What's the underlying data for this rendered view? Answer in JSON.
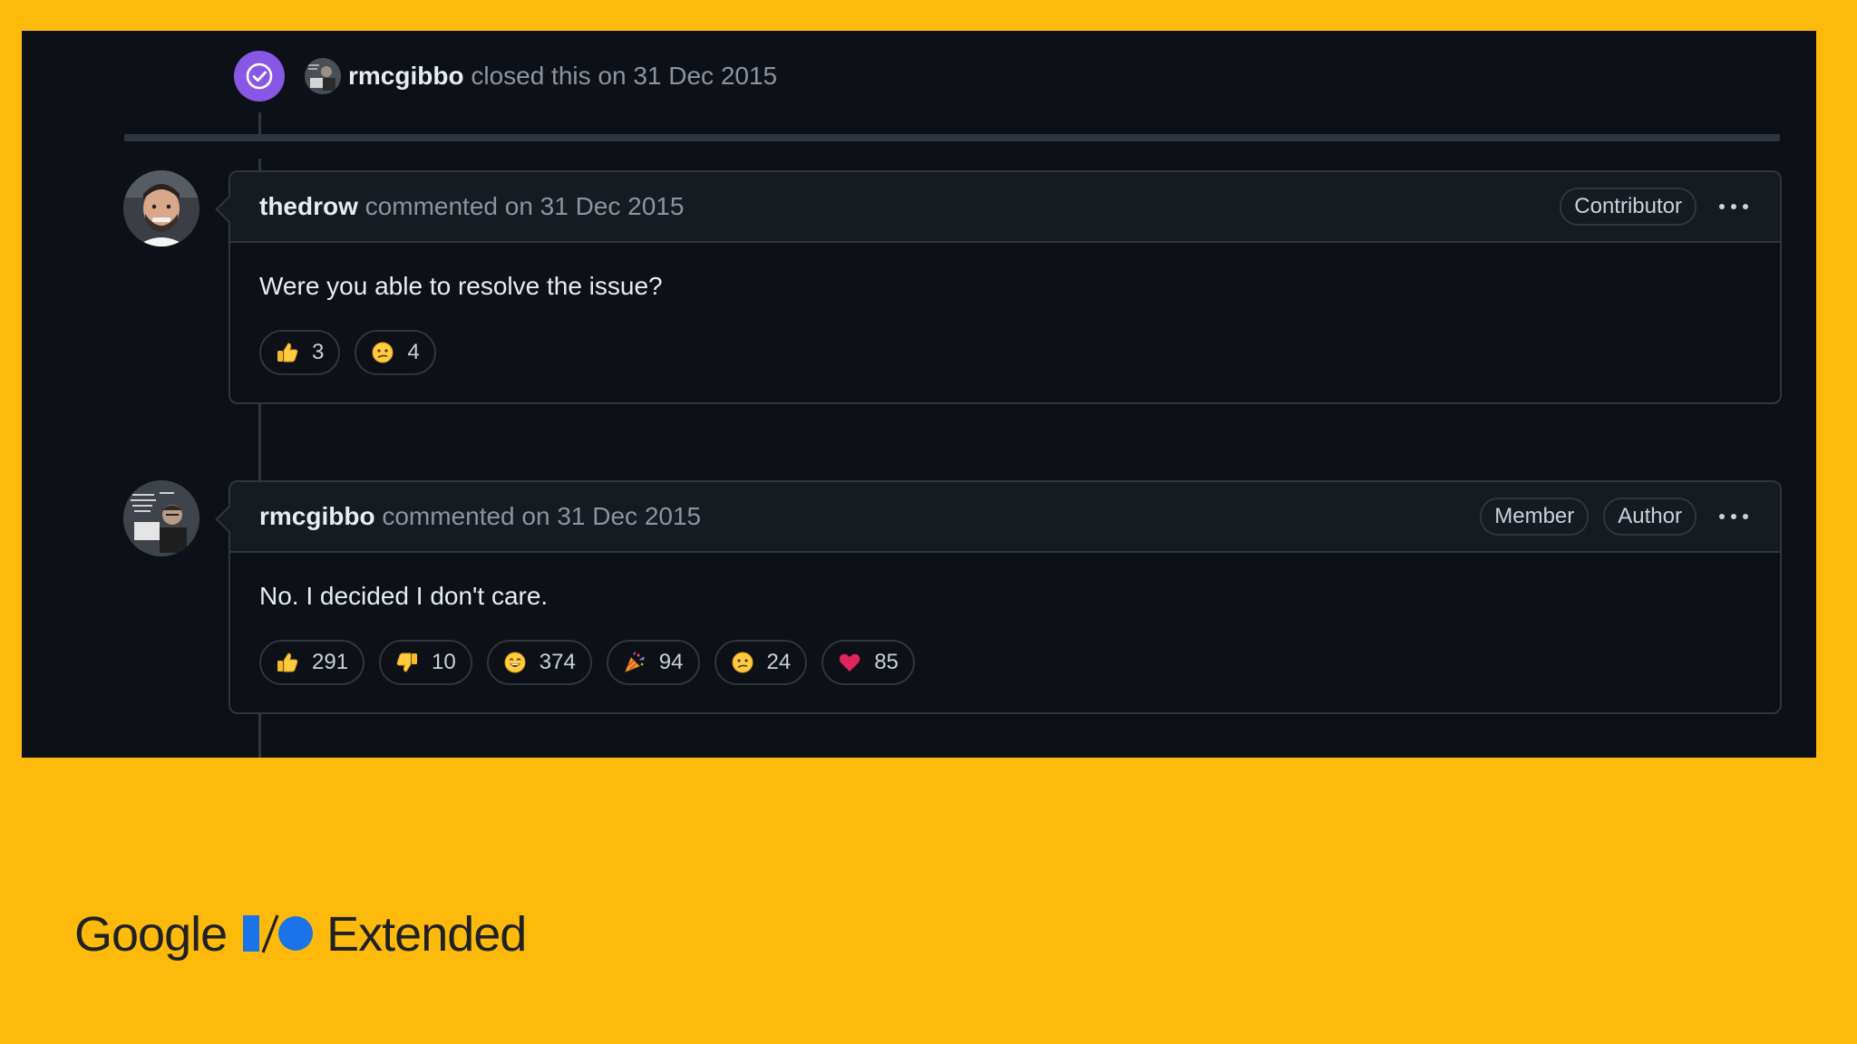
{
  "closed_event": {
    "user": "rmcgibbo",
    "text": "closed this on 31 Dec 2015",
    "icon": "check-circle-icon",
    "badge_color": "#8957e5"
  },
  "comments": [
    {
      "user": "thedrow",
      "meta": "commented on 31 Dec 2015",
      "badges": [
        "Contributor"
      ],
      "body": "Were you able to resolve the issue?",
      "reactions": [
        {
          "emoji": "thumbs-up-icon",
          "count": "3"
        },
        {
          "emoji": "confused-face-icon",
          "count": "4"
        }
      ]
    },
    {
      "user": "rmcgibbo",
      "meta": "commented on 31 Dec 2015",
      "badges": [
        "Member",
        "Author"
      ],
      "body": "No. I decided I don't care.",
      "reactions": [
        {
          "emoji": "thumbs-up-icon",
          "count": "291"
        },
        {
          "emoji": "thumbs-down-icon",
          "count": "10"
        },
        {
          "emoji": "laugh-icon",
          "count": "374"
        },
        {
          "emoji": "hooray-icon",
          "count": "94"
        },
        {
          "emoji": "confused-face-icon",
          "count": "24"
        },
        {
          "emoji": "heart-icon",
          "count": "85"
        }
      ]
    }
  ],
  "footer": {
    "brand": "Google",
    "io": "I/O",
    "suffix": "Extended"
  },
  "colors": {
    "background": "#FDBA0B",
    "panel": "#0d1117",
    "io_blue": "#1A73E8"
  }
}
